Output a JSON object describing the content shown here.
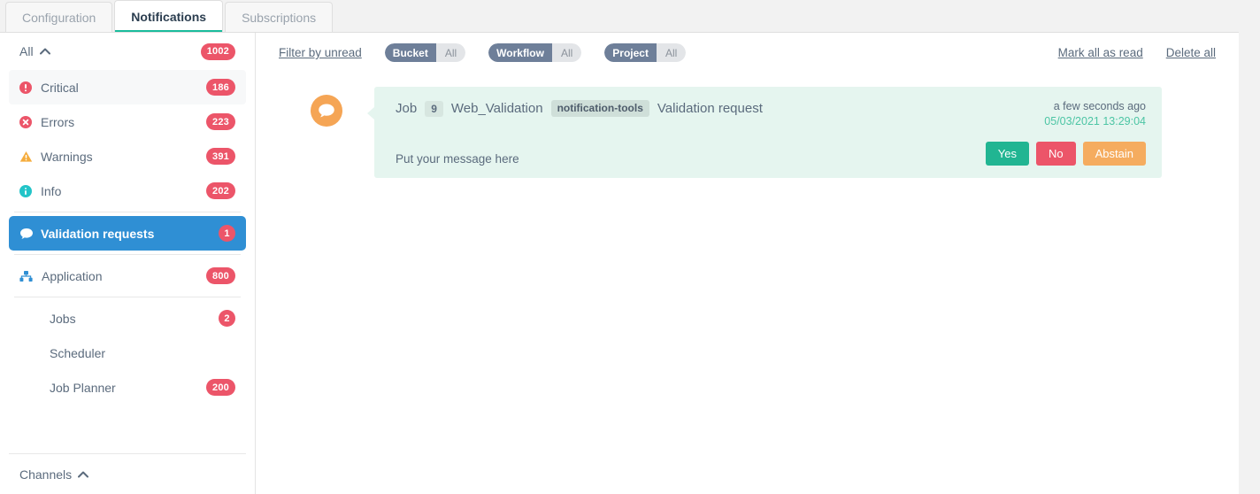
{
  "tabs": [
    {
      "label": "Configuration",
      "active": false
    },
    {
      "label": "Notifications",
      "active": true
    },
    {
      "label": "Subscriptions",
      "active": false
    }
  ],
  "sidebar": {
    "all_header": {
      "label": "All",
      "count": "1002",
      "chevron": "chevron-up-icon"
    },
    "severity_items": [
      {
        "label": "Critical",
        "count": "186",
        "icon": "critical-icon",
        "color": "#ec5569"
      },
      {
        "label": "Errors",
        "count": "223",
        "icon": "error-icon",
        "color": "#ec5569"
      },
      {
        "label": "Warnings",
        "count": "391",
        "icon": "warning-icon",
        "color": "#f5ac3c"
      },
      {
        "label": "Info",
        "count": "202",
        "icon": "info-icon",
        "color": "#23c4c8"
      }
    ],
    "validation": {
      "label": "Validation requests",
      "count": "1",
      "icon": "chat-bubble-icon"
    },
    "application": {
      "label": "Application",
      "count": "800",
      "icon": "sitemap-icon",
      "color": "#2f8fd4"
    },
    "app_children": [
      {
        "label": "Jobs",
        "count": "2"
      },
      {
        "label": "Scheduler",
        "count": ""
      },
      {
        "label": "Job Planner",
        "count": "200"
      }
    ],
    "channels": {
      "label": "Channels",
      "chevron": "chevron-up-icon"
    }
  },
  "toolbar": {
    "filter_unread": "Filter by unread",
    "filters": [
      {
        "key": "Bucket",
        "value": "All"
      },
      {
        "key": "Workflow",
        "value": "All"
      },
      {
        "key": "Project",
        "value": "All"
      }
    ],
    "mark_all_read": "Mark all as read",
    "delete_all": "Delete all"
  },
  "notification": {
    "avatar_icon": "chat-bubble-icon",
    "type_label": "Job",
    "job_number": "9",
    "job_name": "Web_Validation",
    "tag": "notification-tools",
    "subject": "Validation request",
    "relative_time": "a few seconds ago",
    "absolute_time": "05/03/2021 13:29:04",
    "message": "Put your message here",
    "buttons": [
      {
        "label": "Yes",
        "name": "yes-button",
        "cls": "btn-yes"
      },
      {
        "label": "No",
        "name": "no-button",
        "cls": "btn-no"
      },
      {
        "label": "Abstain",
        "name": "abstain-button",
        "cls": "btn-abs"
      }
    ]
  },
  "colors": {
    "accent_blue": "#2f8fd4",
    "badge_red": "#ec5569",
    "card_bg": "#e5f5ef",
    "green": "#21b592",
    "orange": "#f5ac5f",
    "tab_underline": "#1abc9c"
  }
}
